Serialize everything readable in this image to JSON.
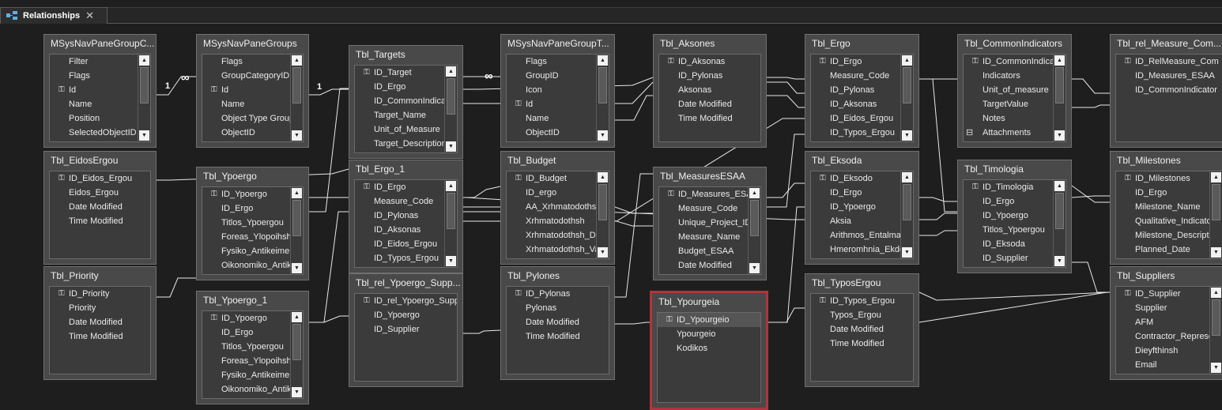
{
  "tab": {
    "title": "Relationships",
    "close": "✕"
  },
  "icons": {
    "tab": "relationships-icon",
    "key": "key-icon",
    "attach": "attachment-icon"
  },
  "colors": {
    "background": "#1e1e1e",
    "table": "#494949",
    "selection": "#b3333c",
    "line": "#e8e8e8"
  },
  "tables": [
    {
      "id": "msysnavpanegroupc",
      "title": "MSysNavPaneGroupC...",
      "scroll": true,
      "fields": [
        {
          "n": "Filter"
        },
        {
          "n": "Flags"
        },
        {
          "n": "Id",
          "pk": true
        },
        {
          "n": "Name"
        },
        {
          "n": "Position"
        },
        {
          "n": "SelectedObjectID"
        }
      ]
    },
    {
      "id": "msysnavpanegroups",
      "title": "MSysNavPaneGroups",
      "scroll": true,
      "fields": [
        {
          "n": "Flags"
        },
        {
          "n": "GroupCategoryID"
        },
        {
          "n": "Id",
          "pk": true
        },
        {
          "n": "Name"
        },
        {
          "n": "Object Type Group"
        },
        {
          "n": "ObjectID"
        }
      ]
    },
    {
      "id": "tbl_targets",
      "title": "Tbl_Targets",
      "scroll": true,
      "fields": [
        {
          "n": "ID_Target",
          "pk": true
        },
        {
          "n": "ID_Ergo"
        },
        {
          "n": "ID_CommonIndicator"
        },
        {
          "n": "Target_Name"
        },
        {
          "n": "Unit_of_Measure"
        },
        {
          "n": "Target_Description"
        }
      ]
    },
    {
      "id": "msysnavpanegroupt",
      "title": "MSysNavPaneGroupT...",
      "scroll": true,
      "fields": [
        {
          "n": "Flags"
        },
        {
          "n": "GroupID"
        },
        {
          "n": "Icon"
        },
        {
          "n": "Id",
          "pk": true
        },
        {
          "n": "Name"
        },
        {
          "n": "ObjectID"
        }
      ]
    },
    {
      "id": "tbl_aksones",
      "title": "Tbl_Aksones",
      "scroll": false,
      "fields": [
        {
          "n": "ID_Aksonas",
          "pk": true
        },
        {
          "n": "ID_Pylonas"
        },
        {
          "n": "Aksonas"
        },
        {
          "n": "Date Modified"
        },
        {
          "n": "Time Modified"
        }
      ]
    },
    {
      "id": "tbl_ergo",
      "title": "Tbl_Ergo",
      "scroll": true,
      "fields": [
        {
          "n": "ID_Ergo",
          "pk": true
        },
        {
          "n": "Measure_Code"
        },
        {
          "n": "ID_Pylonas"
        },
        {
          "n": "ID_Aksonas"
        },
        {
          "n": "ID_Eidos_Ergou"
        },
        {
          "n": "ID_Typos_Ergou"
        }
      ]
    },
    {
      "id": "tbl_commonindicators",
      "title": "Tbl_CommonIndicators",
      "scroll": true,
      "fields": [
        {
          "n": "ID_CommonIndicator",
          "pk": true
        },
        {
          "n": "Indicators"
        },
        {
          "n": "Unit_of_measure"
        },
        {
          "n": "TargetValue"
        },
        {
          "n": "Notes"
        },
        {
          "n": "Attachments",
          "att": true
        }
      ]
    },
    {
      "id": "tbl_rel_measure_com",
      "title": "Tbl_rel_Measure_Com...",
      "scroll": false,
      "fields": [
        {
          "n": "ID_RelMeasure_Com",
          "pk": true
        },
        {
          "n": "ID_Measures_ESAA"
        },
        {
          "n": "ID_CommonIndicator"
        }
      ]
    },
    {
      "id": "tbl_eidosergou",
      "title": "Tbl_EidosErgou",
      "scroll": false,
      "fields": [
        {
          "n": "ID_Eidos_Ergou",
          "pk": true
        },
        {
          "n": "Eidos_Ergou"
        },
        {
          "n": "Date Modified"
        },
        {
          "n": "Time Modified"
        }
      ]
    },
    {
      "id": "tbl_ypoergo",
      "title": "Tbl_Ypoergo",
      "scroll": true,
      "fields": [
        {
          "n": "ID_Ypoergo",
          "pk": true
        },
        {
          "n": "ID_Ergo"
        },
        {
          "n": "Titlos_Ypoergou"
        },
        {
          "n": "Foreas_Ylopoihshs"
        },
        {
          "n": "Fysiko_Antikeimeno"
        },
        {
          "n": "Oikonomiko_Antikeimeno"
        }
      ]
    },
    {
      "id": "tbl_ergo_1",
      "title": "Tbl_Ergo_1",
      "scroll": true,
      "fields": [
        {
          "n": "ID_Ergo",
          "pk": true
        },
        {
          "n": "Measure_Code"
        },
        {
          "n": "ID_Pylonas"
        },
        {
          "n": "ID_Aksonas"
        },
        {
          "n": "ID_Eidos_Ergou"
        },
        {
          "n": "ID_Typos_Ergou"
        }
      ]
    },
    {
      "id": "tbl_budget",
      "title": "Tbl_Budget",
      "scroll": true,
      "fields": [
        {
          "n": "ID_Budget",
          "pk": true
        },
        {
          "n": "ID_ergo"
        },
        {
          "n": "AA_Xrhmatodothshs"
        },
        {
          "n": "Xrhmatodothsh"
        },
        {
          "n": "Xrhmatodothsh_Date"
        },
        {
          "n": "Xrhmatodothsh_Value"
        }
      ]
    },
    {
      "id": "tbl_measuresesaa",
      "title": "Tbl_MeasuresESAA",
      "scroll": true,
      "fields": [
        {
          "n": "ID_Measures_ESAA",
          "pk": true
        },
        {
          "n": "Measure_Code"
        },
        {
          "n": "Unique_Project_ID"
        },
        {
          "n": "Measure_Name"
        },
        {
          "n": "Budget_ESAA"
        },
        {
          "n": "Date Modified"
        }
      ]
    },
    {
      "id": "tbl_eksoda",
      "title": "Tbl_Eksoda",
      "scroll": true,
      "fields": [
        {
          "n": "ID_Eksodo",
          "pk": true
        },
        {
          "n": "ID_Ergo"
        },
        {
          "n": "ID_Ypoergo"
        },
        {
          "n": "Aksia"
        },
        {
          "n": "Arithmos_Entalmatos"
        },
        {
          "n": "Hmeromhnia_Ekdoshs"
        }
      ]
    },
    {
      "id": "tbl_timologia",
      "title": "Tbl_Timologia",
      "scroll": true,
      "fields": [
        {
          "n": "ID_Timologia",
          "pk": true
        },
        {
          "n": "ID_Ergo"
        },
        {
          "n": "ID_Ypoergo"
        },
        {
          "n": "Titlos_Ypoergou"
        },
        {
          "n": "ID_Eksoda"
        },
        {
          "n": "ID_Supplier"
        }
      ]
    },
    {
      "id": "tbl_milestones",
      "title": "Tbl_Milestones",
      "scroll": true,
      "fields": [
        {
          "n": "ID_Milestones",
          "pk": true
        },
        {
          "n": "ID_Ergo"
        },
        {
          "n": "Milestone_Name"
        },
        {
          "n": "Qualitative_Indicator"
        },
        {
          "n": "Milestone_Description"
        },
        {
          "n": "Planned_Date"
        }
      ]
    },
    {
      "id": "tbl_priority",
      "title": "Tbl_Priority",
      "scroll": false,
      "fields": [
        {
          "n": "ID_Priority",
          "pk": true
        },
        {
          "n": "Priority"
        },
        {
          "n": "Date Modified"
        },
        {
          "n": "Time Modified"
        }
      ]
    },
    {
      "id": "tbl_ypoergo_1",
      "title": "Tbl_Ypoergo_1",
      "scroll": true,
      "fields": [
        {
          "n": "ID_Ypoergo",
          "pk": true
        },
        {
          "n": "ID_Ergo"
        },
        {
          "n": "Titlos_Ypoergou"
        },
        {
          "n": "Foreas_Ylopoihshs"
        },
        {
          "n": "Fysiko_Antikeimeno"
        },
        {
          "n": "Oikonomiko_Antikeimeno"
        }
      ]
    },
    {
      "id": "tbl_rel_ypoergo_supp",
      "title": "Tbl_rel_Ypoergo_Supp...",
      "scroll": false,
      "fields": [
        {
          "n": "ID_rel_Ypoergo_Supplier",
          "pk": true
        },
        {
          "n": "ID_Ypoergo"
        },
        {
          "n": "ID_Supplier"
        }
      ]
    },
    {
      "id": "tbl_pylones",
      "title": "Tbl_Pylones",
      "scroll": false,
      "fields": [
        {
          "n": "ID_Pylonas",
          "pk": true
        },
        {
          "n": "Pylonas"
        },
        {
          "n": "Date Modified"
        },
        {
          "n": "Time Modified"
        }
      ]
    },
    {
      "id": "tbl_ypourgeia",
      "title": "Tbl_Ypourgeia",
      "scroll": false,
      "selected": true,
      "fields": [
        {
          "n": "ID_Ypourgeio",
          "pk": true,
          "hl": true
        },
        {
          "n": "Ypourgeio"
        },
        {
          "n": "Kodikos"
        }
      ]
    },
    {
      "id": "tbl_typosergou",
      "title": "Tbl_TyposErgou",
      "scroll": false,
      "fields": [
        {
          "n": "ID_Typos_Ergou",
          "pk": true
        },
        {
          "n": "Typos_Ergou"
        },
        {
          "n": "Date Modified"
        },
        {
          "n": "Time Modified"
        }
      ]
    },
    {
      "id": "tbl_suppliers",
      "title": "Tbl_Suppliers",
      "scroll": true,
      "fields": [
        {
          "n": "ID_Supplier",
          "pk": true
        },
        {
          "n": "Supplier"
        },
        {
          "n": "AFM"
        },
        {
          "n": "Contractor_Representative"
        },
        {
          "n": "Dieyfthinsh"
        },
        {
          "n": "Email"
        }
      ]
    }
  ],
  "cardinality": [
    {
      "id": "c1",
      "one": "1",
      "many": "∞"
    },
    {
      "id": "c2",
      "one": "1",
      "many": "∞"
    }
  ]
}
